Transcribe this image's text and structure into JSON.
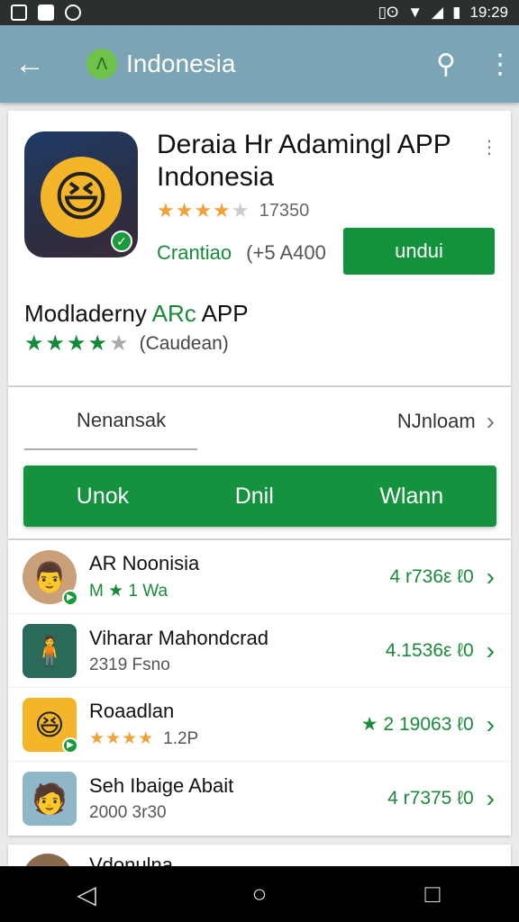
{
  "status_bar": {
    "time": "19:29",
    "icons": [
      "image-icon",
      "mail-icon",
      "voicemail-icon",
      "vibrate-icon",
      "wifi-icon",
      "signal-icon",
      "battery-icon"
    ]
  },
  "app_bar": {
    "title": "Indonesia",
    "back_icon": "arrow-left-icon",
    "search_icon": "search-icon",
    "more_icon": "more-vert-icon",
    "color": "#7ba4b5"
  },
  "app": {
    "title": "Deraia Hr Adamingl APP Indonesia",
    "stars": 4,
    "max_stars": 5,
    "rating_count": "17350",
    "download_status": "Crantiao",
    "download_size": "(+5 A400",
    "install_label": "undui"
  },
  "second": {
    "title_prefix": "Modladerny ",
    "title_green": "ARc",
    "title_suffix": " APP",
    "stars": 4,
    "max_stars": 5,
    "meta": "(Caudean)"
  },
  "tabs": {
    "left_label": "Nenansak",
    "right_label": "NJnloam",
    "bar_items": [
      "Unok",
      "Dnil",
      "Wlann"
    ]
  },
  "list": [
    {
      "name": "AR Noonisia",
      "sub": "M ★ 1 Wa",
      "sub_green": true,
      "right": "4 r736ε ℓ0"
    },
    {
      "name": "Viharar Mahondcrad",
      "sub": "2319 Fsno",
      "sub_green": false,
      "right": "4.1536ε ℓ0"
    },
    {
      "name": "Roaadlan",
      "sub": "1.2P",
      "stars": "★★★★",
      "sub_green": false,
      "right": "★ 2 19063 ℓ0"
    },
    {
      "name": "Seh Ibaige Abait",
      "sub": "2000 3r30",
      "sub_green": false,
      "right": "4 r7375 ℓ0"
    }
  ],
  "peek": {
    "name": "Vdonulna"
  },
  "colors": {
    "primary_green": "#14923d",
    "star_orange": "#f0a23a",
    "app_bar": "#7ba4b5"
  },
  "nav": {
    "back": "back-icon",
    "home": "home-icon",
    "recents": "recents-icon"
  }
}
